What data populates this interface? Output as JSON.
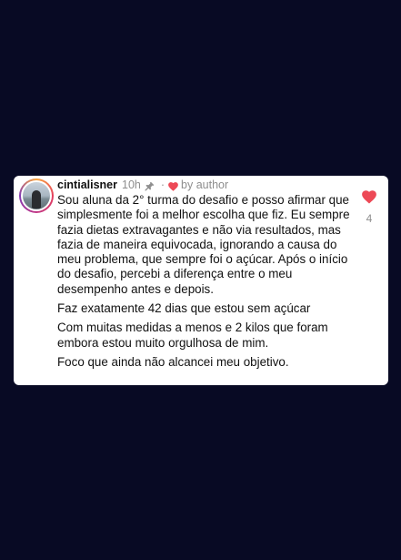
{
  "comment": {
    "username": "cintialisner",
    "time": "10h",
    "separator": "·",
    "author_label": "by author",
    "like_count": "4",
    "accent_color": "#ed4956",
    "paragraphs": [
      "Sou aluna da 2° turma do desafio e posso afirmar que simplesmente foi a melhor escolha que fiz. Eu sempre fazia dietas extravagantes e não via resultados, mas fazia de maneira equivocada, ignorando a causa do meu problema, que sempre foi o açúcar. Após o início do desafio, percebi a diferença entre o meu desempenho antes e depois.",
      "Faz exatamente 42 dias que estou sem açúcar",
      "Com muitas medidas a menos e 2 kilos que foram embora estou muito orgulhosa de mim.",
      "Foco que ainda não alcancei meu objetivo."
    ],
    "icons": {
      "pin": "pin-icon",
      "author_heart": "heart-icon",
      "like": "heart-filled-icon"
    }
  }
}
